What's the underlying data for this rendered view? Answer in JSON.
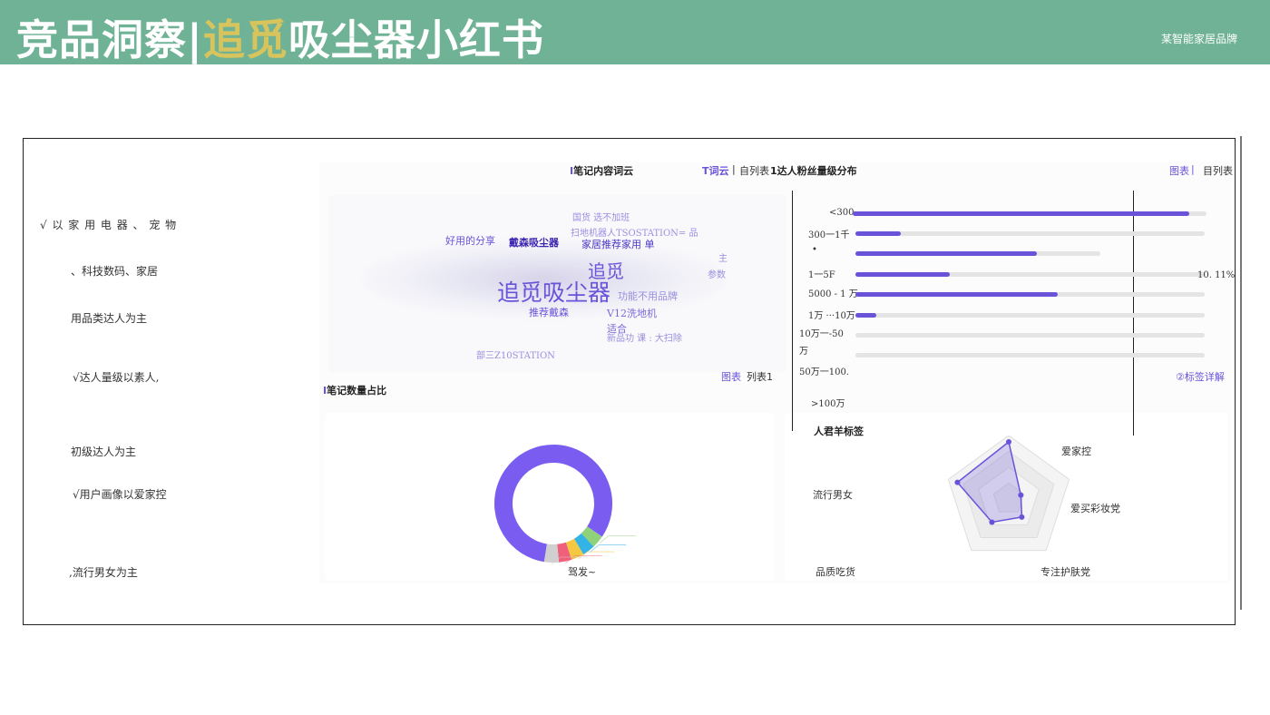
{
  "header": {
    "title_part1": "竞品洞察|",
    "title_highlight": "追觅",
    "title_part2": "吸尘器小红书",
    "brand": "某智能家居品牌",
    "bg_color": "#6fb295",
    "highlight_color": "#d8c45c"
  },
  "summary": [
    "√ 以 家 用 电 器 、 宠 物",
    "、科技数码、家居",
    "用品类达人为主",
    "√达人量级以素人,",
    "初级达人为主",
    "√用户画像以爱家控",
    ",流行男女为主"
  ],
  "wordcloud": {
    "title_marker": "I",
    "title": "笔记内容词云",
    "view_active": "T词云",
    "view_sep": "|",
    "view_other": "自列表",
    "footer_chart": "图表",
    "footer_list": "列表1",
    "words": [
      {
        "text": "国货 选不加班",
        "color": "#9a8fe0"
      },
      {
        "text": "扫地机器人TSOSTATION= 品",
        "color": "#9a8fe0"
      },
      {
        "text": "好用的分享",
        "color": "#6a52d9"
      },
      {
        "text": "戴森吸尘器",
        "color": "#3a22b0"
      },
      {
        "text": "家居推荐家用 单",
        "color": "#4a36c4"
      },
      {
        "text": "主",
        "color": "#9a8fe0"
      },
      {
        "text": "参数",
        "color": "#9a8fe0"
      },
      {
        "text": "追觅",
        "color": "#6a52d9"
      },
      {
        "text": "追觅吸尘器",
        "color": "#6a52d9"
      },
      {
        "text": "功能不用品牌",
        "color": "#9a8fe0"
      },
      {
        "text": "推荐戴森",
        "color": "#6a52d9"
      },
      {
        "text": "V12洗地机",
        "color": "#7a68d8"
      },
      {
        "text": "适合",
        "color": "#7a68d8"
      },
      {
        "text": "新品功 课 : 大扫除",
        "color": "#9a8fe0"
      },
      {
        "text": "部三Z10STATION",
        "color": "#9a8fe0"
      }
    ]
  },
  "notes_share": {
    "title_marker": "I",
    "title": "笔记数量占比",
    "center_label": "驾发~"
  },
  "fans": {
    "title": "1达人粉丝量级分布",
    "link_chart": "图表",
    "link_sep": "|",
    "link_list": "目列表",
    "footer_link": "②标签详解",
    "side_value": "10. 11%",
    "labels": [
      "<300",
      "300一1千",
      "•",
      "1一5F",
      "5000 - 1 万",
      "1万 ···10万",
      "10万一-50",
      "万",
      "50万一100.",
      ">100万"
    ],
    "bar_values": [
      0.95,
      0.13,
      0.74,
      0.27,
      0.58,
      0.06,
      0.0,
      0.0
    ]
  },
  "persona": {
    "title": "人君羊标签",
    "labels": [
      "爱家控",
      "爱买彩妆党",
      "专注护肤党",
      "品质吃货",
      "流行男女"
    ],
    "values": [
      0.9,
      0.2,
      0.35,
      0.45,
      0.85
    ],
    "accent_color": "#6a52d9"
  },
  "donut": {
    "accent_color": "#7a5cf0",
    "segments": [
      {
        "color": "#7a5cf0",
        "value": 82
      },
      {
        "color": "#8fd27a",
        "value": 3.5
      },
      {
        "color": "#33b3e6",
        "value": 3.5
      },
      {
        "color": "#f5c842",
        "value": 3.5
      },
      {
        "color": "#f0607a",
        "value": 3.5
      },
      {
        "color": "#d0d0d0",
        "value": 4
      }
    ]
  }
}
